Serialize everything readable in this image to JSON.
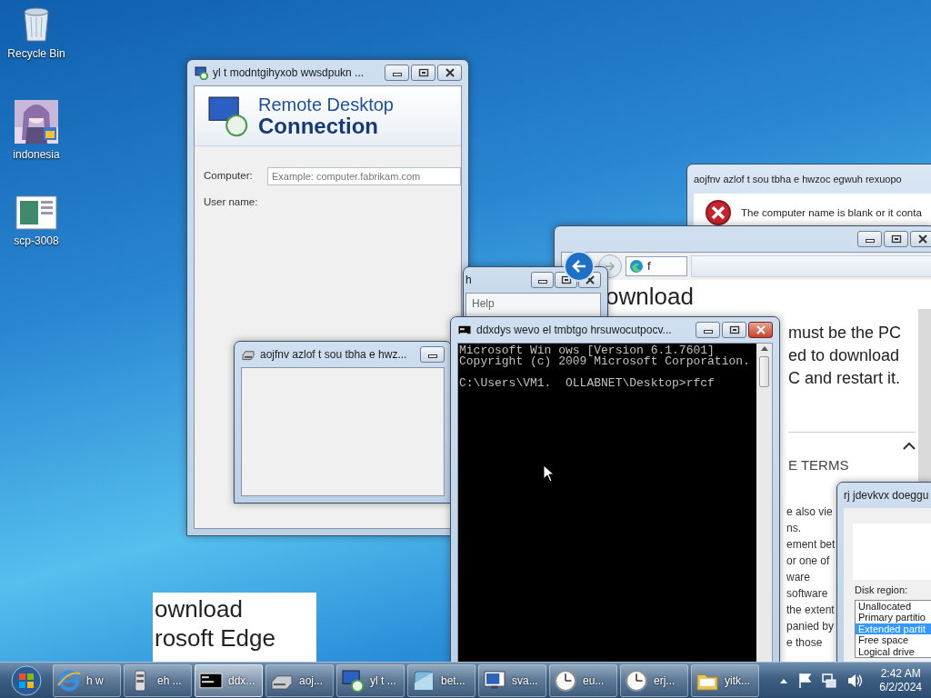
{
  "desktop_icons": [
    {
      "label": "Recycle Bin",
      "kind": "recycle"
    },
    {
      "label": "indonesia"
    },
    {
      "label": "scp-3008",
      "kind": "document"
    }
  ],
  "background_window": {
    "heading_lines": [
      "ownload",
      "rosoft Edge"
    ]
  },
  "help_window": {
    "title": "h",
    "menu": [
      "Help"
    ]
  },
  "rdc_window": {
    "title": "yl t modntgihyxob wwsdpukn ...",
    "banner_line_1": "Remote Desktop",
    "banner_line_2": "Connection",
    "fields": [
      {
        "label": "Computer:",
        "placeholder": "Example: computer.fabrikam.com"
      },
      {
        "label": "User name:"
      }
    ]
  },
  "small_window": {
    "title": "aojfnv  azlof t  sou tbha e   hwz..."
  },
  "error_dialog": {
    "title": "aojfnv  azlof t  sou tbha e   hwzoc egwuh rexuopo",
    "message": "The computer name is blank or it conta"
  },
  "edge_window": {
    "address": "f",
    "heading": "ownload",
    "intro_lines": [
      "must be the PC",
      "ed to download",
      "C and restart it."
    ],
    "section": "E TERMS",
    "body_lines": [
      "e also vie",
      "ns.",
      "ement bet",
      "or one of",
      "ware",
      "software",
      "the extent",
      "panied by",
      "e those"
    ]
  },
  "cmd_window": {
    "title": "ddxdys wevo el  tmbtgo hrsuwocutpocv...",
    "active": true,
    "lines": [
      "Microsoft Win ows [Version 6.1.7601]",
      "Copyright (c) 2009 Microsoft Corporation."
    ],
    "prompt": "C:\\Users\\VM1.  OLLABNET\\Desktop>rfcf"
  },
  "disk_window": {
    "title": "rj jdevkvx doeggu",
    "label": "Disk region:",
    "options": [
      {
        "text": "Unallocated",
        "selected": false
      },
      {
        "text": "Primary partitio",
        "selected": false
      },
      {
        "text": "Extended partit",
        "selected": true
      },
      {
        "text": "Free space",
        "selected": false
      },
      {
        "text": "Logical drive",
        "selected": false
      }
    ]
  },
  "taskbar": {
    "items": [
      {
        "label": "h w",
        "kind": "browser",
        "selected": false
      },
      {
        "label": "eh ...",
        "kind": "server",
        "selected": false
      },
      {
        "label": "ddx...",
        "kind": "console",
        "selected": true
      },
      {
        "label": "aoj...",
        "kind": "drive",
        "selected": false
      },
      {
        "label": "yl t ...",
        "kind": "remote",
        "selected": false
      },
      {
        "label": "bet...",
        "kind": "tile",
        "selected": false
      },
      {
        "label": "sva...",
        "kind": "screen",
        "selected": false
      },
      {
        "label": "eu...",
        "kind": "clock",
        "selected": false
      },
      {
        "label": "erj...",
        "kind": "clock",
        "selected": false
      },
      {
        "label": "yitk...",
        "kind": "folder",
        "selected": false
      }
    ],
    "time": "2:42 AM",
    "date": "6/2/2024"
  }
}
